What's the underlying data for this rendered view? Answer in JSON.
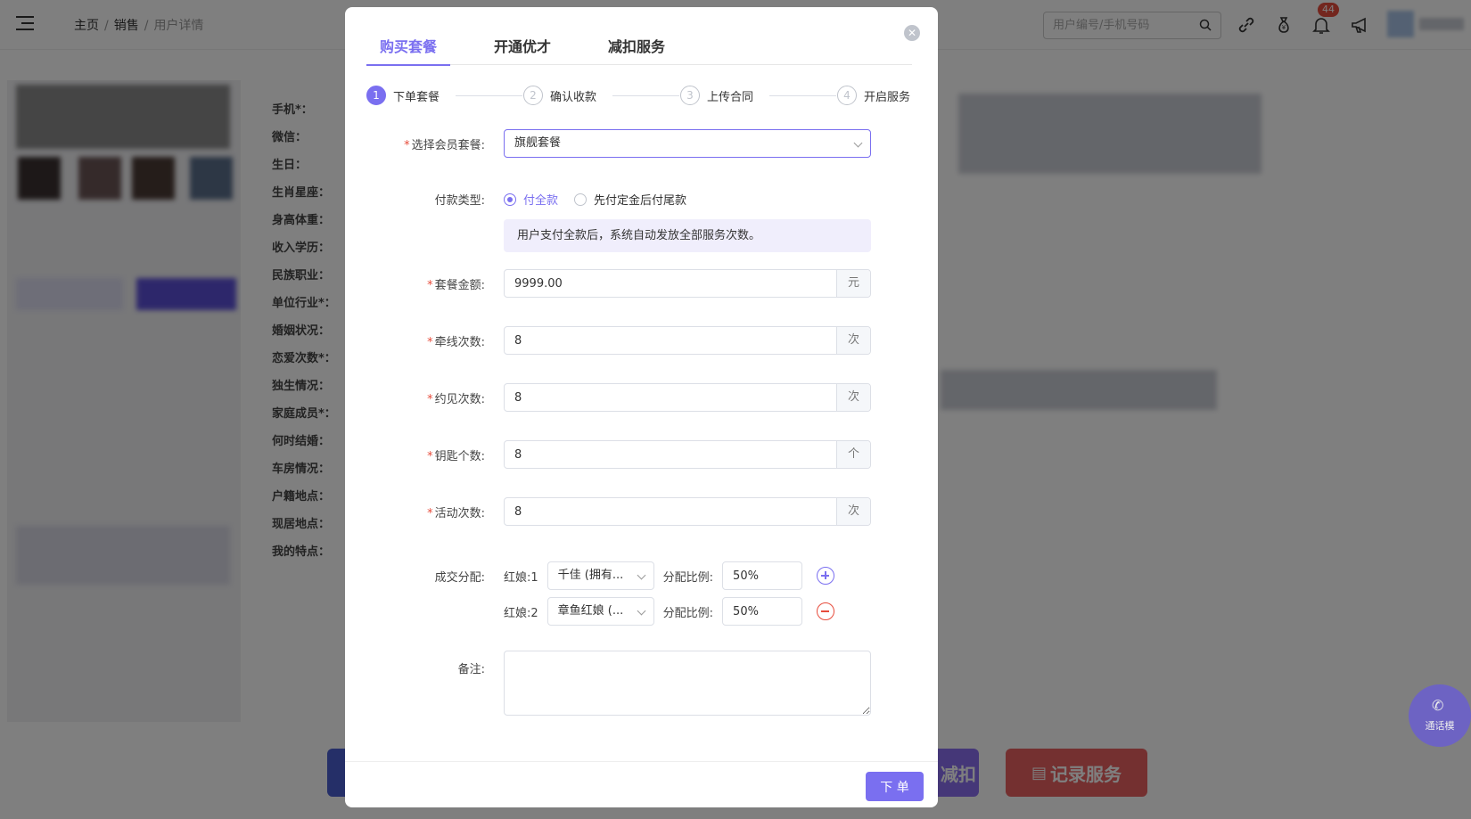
{
  "header": {
    "breadcrumb": [
      "主页",
      "销售",
      "用户详情"
    ],
    "search_placeholder": "用户编号/手机号码",
    "notification_count": "44"
  },
  "profile": {
    "field_labels": [
      "手机*：",
      "微信：",
      "生日：",
      "生肖星座：",
      "身高体重：",
      "收入学历：",
      "民族职业：",
      "单位行业*：",
      "婚姻状况：",
      "恋爱次数*：",
      "独生情况：",
      "家庭成员*：",
      "何时结婚：",
      "车房情况：",
      "户籍地点：",
      "现居地点：",
      "我的特点："
    ]
  },
  "bottom_actions": {
    "discount_label": "减扣",
    "record_label": "记录服务"
  },
  "float_call": {
    "label": "通话模"
  },
  "dialog": {
    "tabs": [
      {
        "label": "购买套餐",
        "active": true
      },
      {
        "label": "开通优才",
        "active": false
      },
      {
        "label": "减扣服务",
        "active": false
      }
    ],
    "steps": [
      {
        "num": "1",
        "label": "下单套餐",
        "active": true
      },
      {
        "num": "2",
        "label": "确认收款",
        "active": false
      },
      {
        "num": "3",
        "label": "上传合同",
        "active": false
      },
      {
        "num": "4",
        "label": "开启服务",
        "active": false
      }
    ],
    "form": {
      "package": {
        "label": "选择会员套餐:",
        "value": "旗舰套餐"
      },
      "payment": {
        "label": "付款类型:",
        "options": [
          "付全款",
          "先付定金后付尾款"
        ],
        "selected": 0,
        "info": "用户支付全款后，系统自动发放全部服务次数。"
      },
      "amount": {
        "label": "套餐金额:",
        "value": "9999.00",
        "unit": "元"
      },
      "match_count": {
        "label": "牵线次数:",
        "value": "8",
        "unit": "次"
      },
      "meet_count": {
        "label": "约见次数:",
        "value": "8",
        "unit": "次"
      },
      "key_count": {
        "label": "钥匙个数:",
        "value": "8",
        "unit": "个"
      },
      "activity_count": {
        "label": "活动次数:",
        "value": "8",
        "unit": "次"
      },
      "split": {
        "label": "成交分配:",
        "rows": [
          {
            "matchmaker_label": "红娘:1",
            "matchmaker": "千佳 (拥有...",
            "ratio_label": "分配比例:",
            "ratio": "50%"
          },
          {
            "matchmaker_label": "红娘:2",
            "matchmaker": "章鱼红娘 (...",
            "ratio_label": "分配比例:",
            "ratio": "50%"
          }
        ]
      },
      "remark": {
        "label": "备注:",
        "value": ""
      }
    },
    "submit_label": "下 单"
  }
}
